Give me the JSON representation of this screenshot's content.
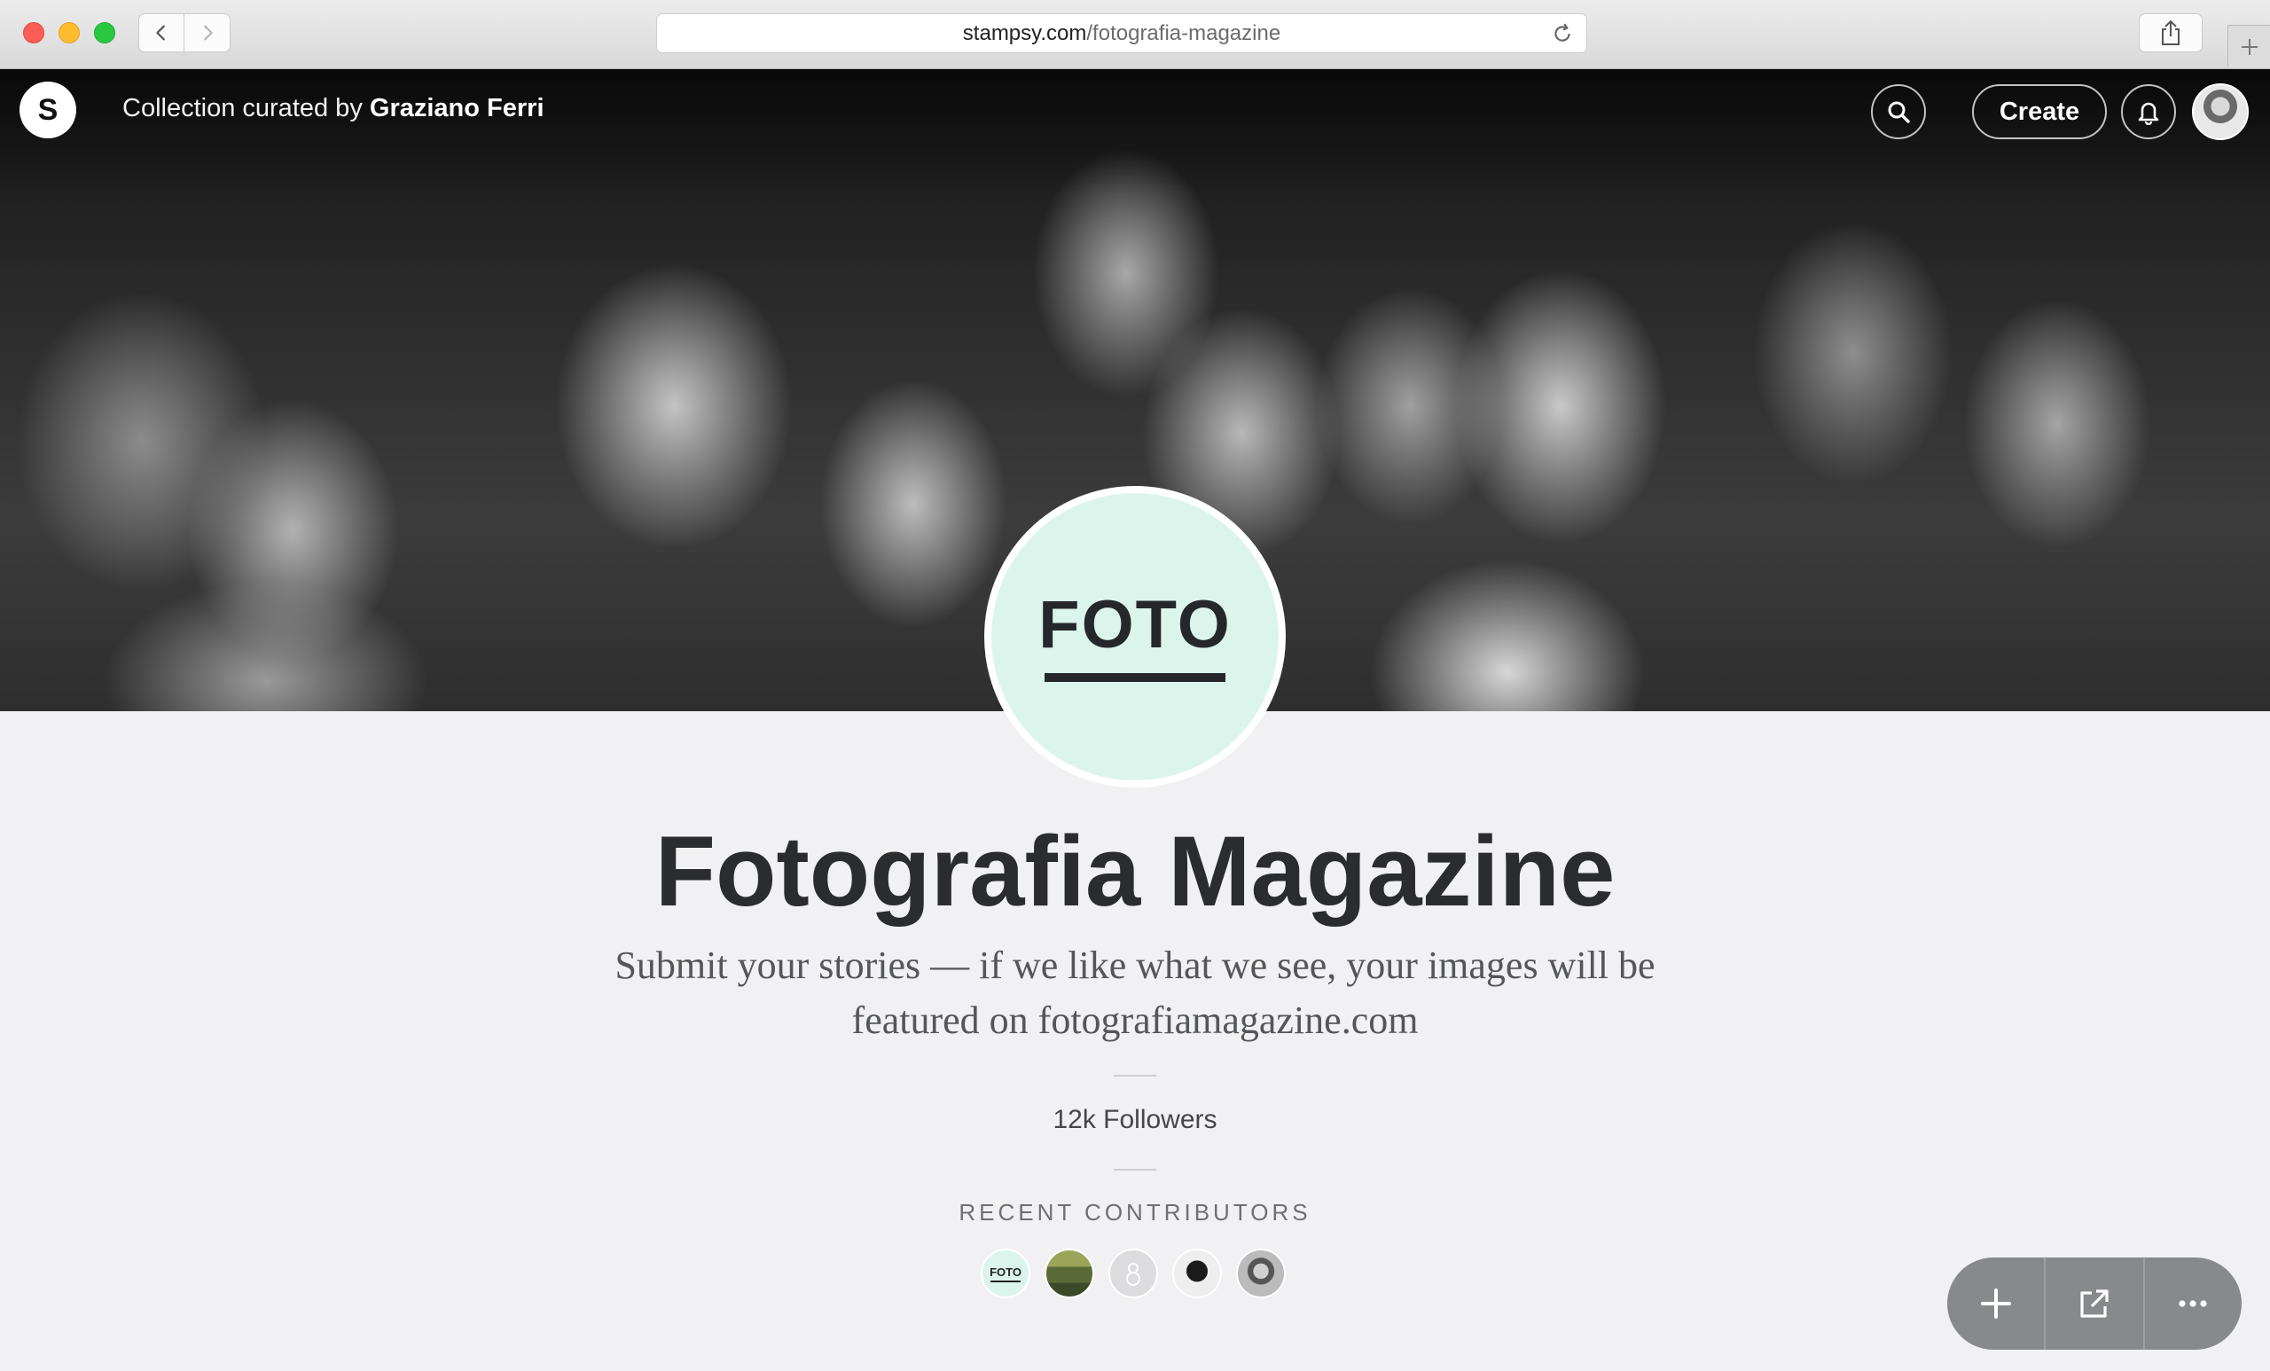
{
  "browser": {
    "url_domain": "stampsy.com",
    "url_path": "/fotografia-magazine"
  },
  "header": {
    "logo_letter": "S",
    "curated_prefix": "Collection curated by",
    "curator_name": "Graziano Ferri",
    "create_label": "Create"
  },
  "collection": {
    "badge_text": "FOTO",
    "title": "Fotografia Magazine",
    "description": "Submit your stories — if we like what we see, your images will be featured on fotografiamagazine.com",
    "followers": "12k Followers",
    "recent_contributors_label": "RECENT CONTRIBUTORS",
    "contributors": [
      {
        "type": "logo",
        "text": "FOTO"
      },
      {
        "type": "landscape-photo"
      },
      {
        "type": "default-avatar"
      },
      {
        "type": "portrait-photo"
      },
      {
        "type": "portrait-photo"
      }
    ]
  },
  "actions": {
    "icons": [
      "plus-icon",
      "external-link-icon",
      "more-icon"
    ]
  },
  "colors": {
    "badge_bg": "#dcf5ec",
    "page_bg": "#f1f1f3",
    "action_bar": "#88898d"
  }
}
